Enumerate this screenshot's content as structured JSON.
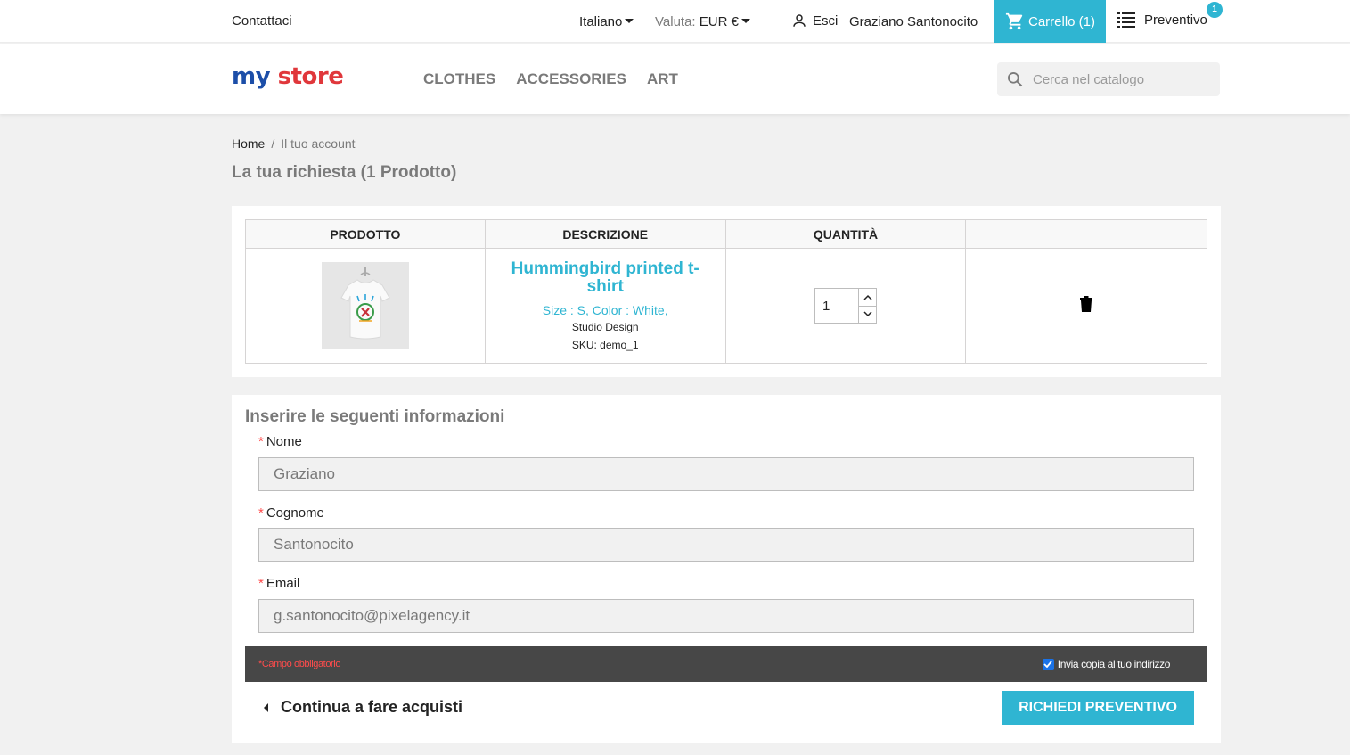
{
  "topbar": {
    "contact": "Contattaci",
    "language": "Italiano",
    "currency_label": "Valuta:",
    "currency_value": "EUR €",
    "logout": "Esci",
    "username": "Graziano Santonocito",
    "cart": "Carrello (1)",
    "quote": "Preventivo",
    "quote_count": "1"
  },
  "header": {
    "logo": {
      "w1": "my",
      "w2": "store"
    },
    "nav": [
      "CLOTHES",
      "ACCESSORIES",
      "ART"
    ],
    "search_placeholder": "Cerca nel catalogo"
  },
  "breadcrumb": {
    "home": "Home",
    "sep": "/",
    "current": "Il tuo account"
  },
  "page_title": "La tua richiesta (1 Prodotto)",
  "table": {
    "headers": [
      "PRODOTTO",
      "DESCRIZIONE",
      "QUANTITÀ",
      ""
    ],
    "rows": [
      {
        "name": "Hummingbird printed t-shirt",
        "attributes": "Size : S, Color : White,",
        "brand": "Studio Design",
        "sku": "SKU: demo_1",
        "quantity": "1"
      }
    ]
  },
  "form": {
    "title": "Inserire le seguenti informazioni",
    "required_mark": "*",
    "fields": [
      {
        "label": "Nome",
        "value": "Graziano"
      },
      {
        "label": "Cognome",
        "value": "Santonocito"
      },
      {
        "label": "Email",
        "value": "g.santonocito@pixelagency.it"
      }
    ],
    "required_note": "*Campo obbligatorio",
    "copy_label": "Invia copia al tuo indirizzo",
    "copy_checked": true,
    "continue": "Continua a fare acquisti",
    "submit": "RICHIEDI PREVENTIVO"
  },
  "colors": {
    "accent": "#2fb5d2",
    "required": "#ff4c4c",
    "darkbar": "#474747"
  }
}
